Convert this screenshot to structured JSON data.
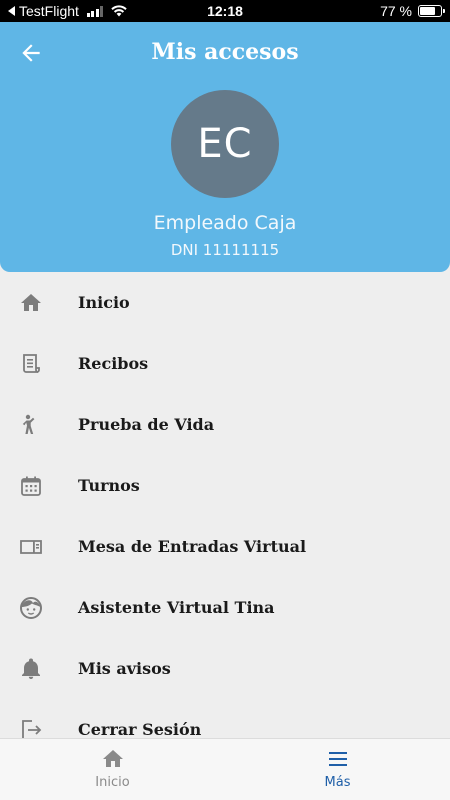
{
  "status_bar": {
    "carrier": "TestFlight",
    "time": "12:18",
    "battery_text": "77 %",
    "battery_level": 0.77
  },
  "header": {
    "title": "Mis accesos",
    "back_icon": "arrow-left-icon",
    "avatar_initials": "EC",
    "user_name": "Empleado Caja",
    "user_dni": "DNI 11111115"
  },
  "menu": {
    "items": [
      {
        "label": "Inicio",
        "icon": "home-icon"
      },
      {
        "label": "Recibos",
        "icon": "receipt-icon"
      },
      {
        "label": "Prueba de Vida",
        "icon": "person-raising-hand-icon"
      },
      {
        "label": "Turnos",
        "icon": "calendar-icon"
      },
      {
        "label": "Mesa de Entradas Virtual",
        "icon": "inbox-tray-icon"
      },
      {
        "label": "Asistente Virtual Tina",
        "icon": "assistant-face-icon"
      },
      {
        "label": "Mis avisos",
        "icon": "bell-icon"
      },
      {
        "label": "Cerrar Sesión",
        "icon": "logout-icon"
      }
    ]
  },
  "tabbar": {
    "tabs": [
      {
        "label": "Inicio",
        "icon": "home-icon",
        "active": false
      },
      {
        "label": "Más",
        "icon": "menu-icon",
        "active": true
      }
    ]
  },
  "colors": {
    "header_bg": "#5fb6e6",
    "avatar_bg": "#657a8a",
    "menu_bg": "#eeeeee",
    "icon_gray": "#7c7c7c",
    "active_tab": "#1f5fa8"
  }
}
